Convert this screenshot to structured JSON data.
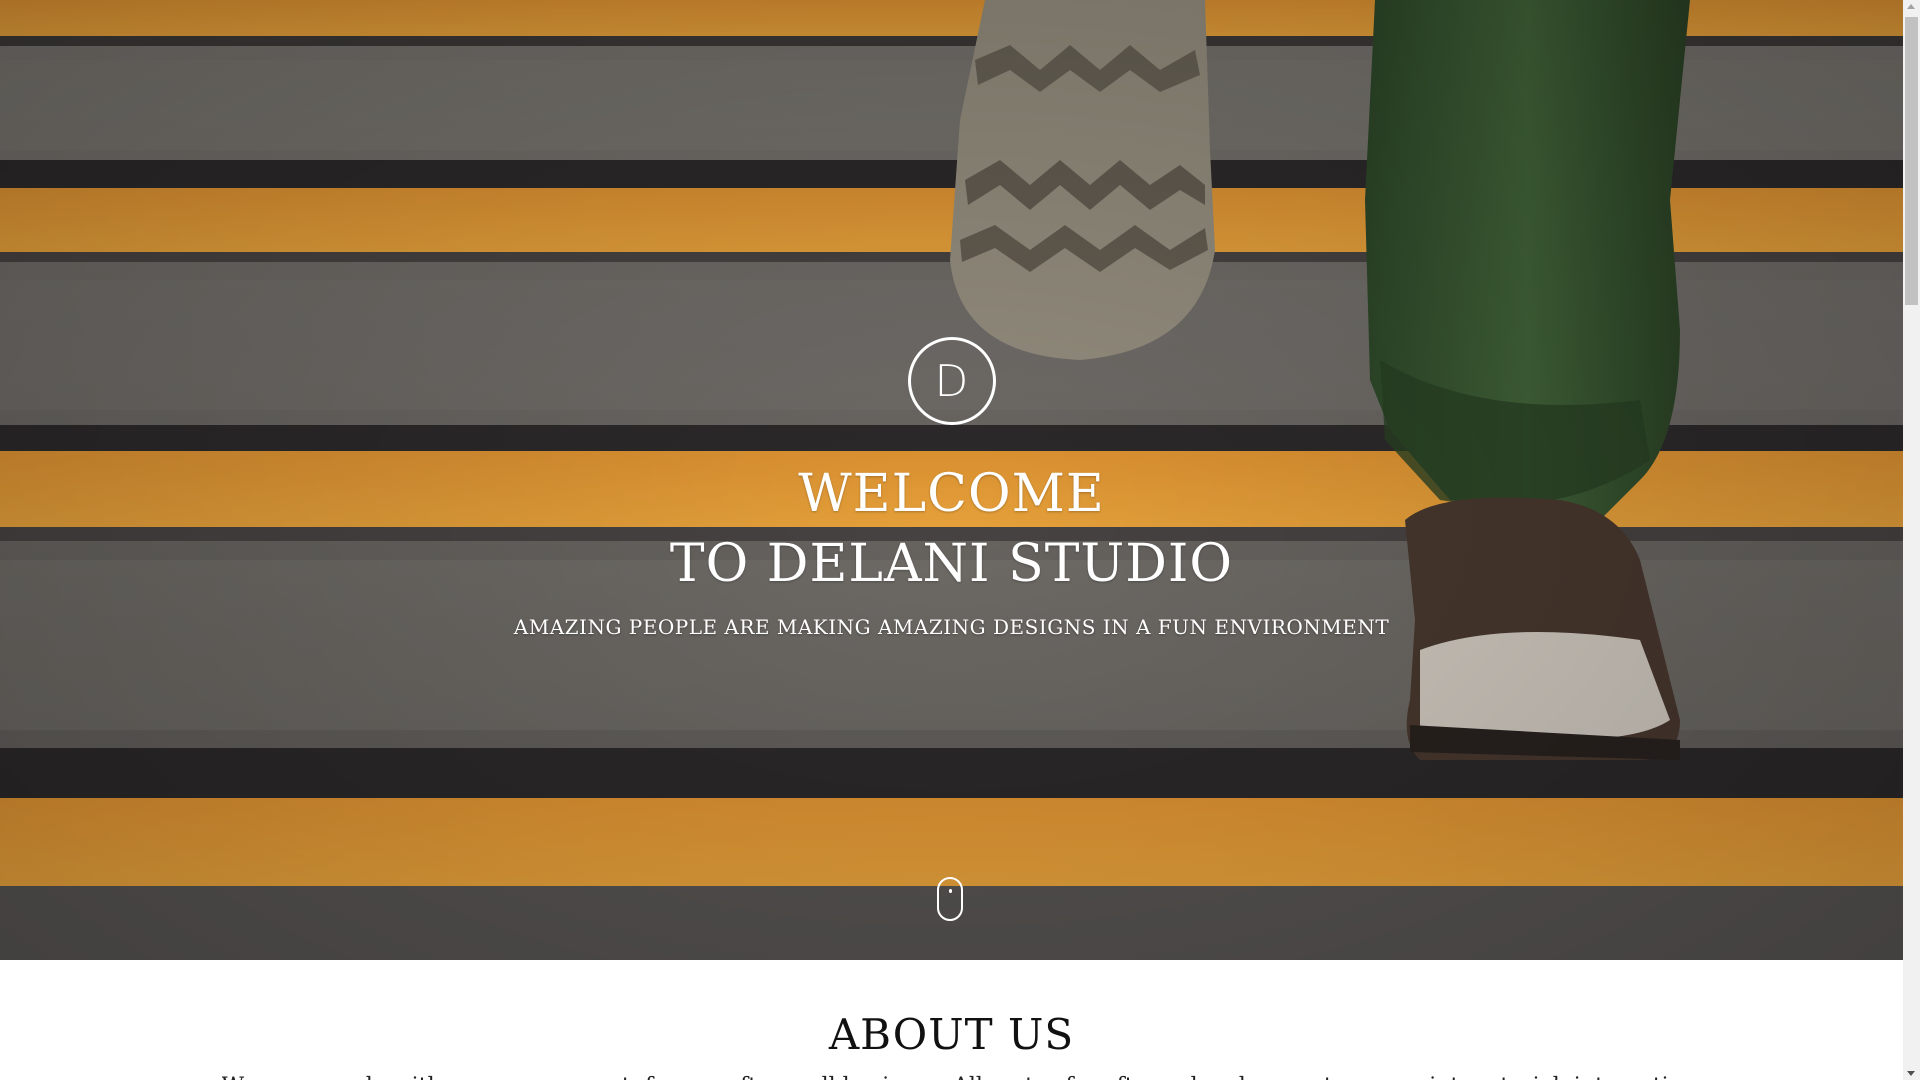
{
  "hero": {
    "logo_letter": "D",
    "title_line1": "WELCOME",
    "title_line2": "TO DELANI STUDIO",
    "subtitle": "AMAZING PEOPLE ARE MAKING AMAZING DESIGNS IN A FUN ENVIRONMENT",
    "scroll_icon": "mouse-scroll-icon",
    "background": "photo of feet climbing stairs with orange stripes"
  },
  "about": {
    "title": "ABOUT US",
    "text": "We were made with a vague concept: for a crafty small business. All sorts of crafts, web, ads, events, any print material, interactive, and mail."
  },
  "colors": {
    "stripe_orange": "#f0a030",
    "step_grey": "#6b6866",
    "text_white": "#ffffff",
    "heading_dark": "#111111"
  }
}
